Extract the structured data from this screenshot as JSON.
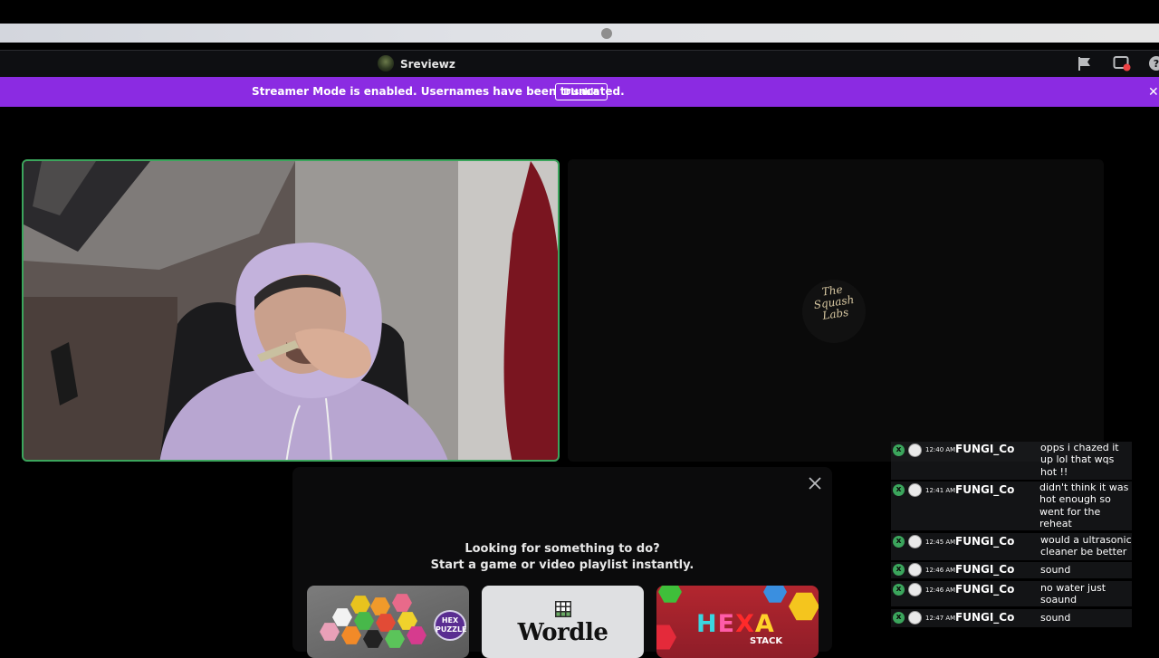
{
  "header": {
    "title": "Sreviewz"
  },
  "banner": {
    "text": "Streamer Mode is enabled. Usernames have been truncated.",
    "disable_label": "Disable",
    "close_glyph": "✕",
    "color": "#8b2be2"
  },
  "tiles": {
    "speaking_border_color": "#3ba55c",
    "logo_text": "The Squash Labs"
  },
  "activity": {
    "title_line1": "Looking for something to do?",
    "title_line2": "Start a game or video playlist instantly.",
    "games": [
      {
        "name": "Hex Puzzle",
        "badge": "HEX PUZZLE"
      },
      {
        "name": "Wordle",
        "title": "Wordle"
      },
      {
        "name": "Hexa Stack",
        "title_letters": [
          "H",
          "E",
          "X",
          "A"
        ],
        "subtitle": "STACK"
      }
    ]
  },
  "chat": [
    {
      "time": "12:40 AM",
      "user": "FUNGI_Co",
      "message": "opps i chazed it up lol that wqs hot !!"
    },
    {
      "time": "12:41 AM",
      "user": "FUNGI_Co",
      "message": "didn't think it was hot enough so went for the reheat"
    },
    {
      "time": "12:45 AM",
      "user": "FUNGI_Co",
      "message": "would a ultrasonic cleaner be better"
    },
    {
      "time": "12:46 AM",
      "user": "FUNGI_Co",
      "message": "sound"
    },
    {
      "time": "12:46 AM",
      "user": "FUNGI_Co",
      "message": "no water just soaund"
    },
    {
      "time": "12:47 AM",
      "user": "FUNGI_Co",
      "message": "sound"
    }
  ],
  "icons": {
    "header": [
      "flag-icon",
      "screen-share-icon",
      "help-icon"
    ],
    "chat_badge": "xbox-icon",
    "chat_badge_glyph": "x"
  }
}
